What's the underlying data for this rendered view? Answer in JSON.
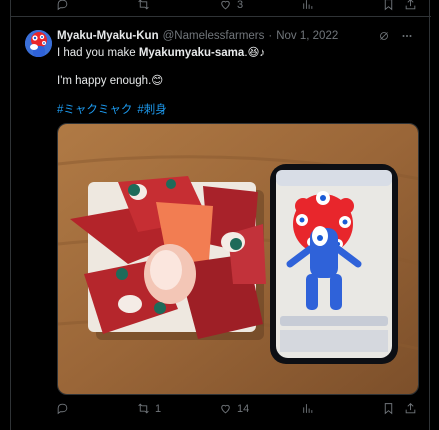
{
  "previous_tweet": {
    "retweets": "",
    "likes": "3",
    "views": ""
  },
  "tweet": {
    "display_name": "Myaku-Myaku-Kun",
    "handle": "@Namelessfarmers",
    "separator": "·",
    "date": "Nov 1, 2022",
    "line1_prefix": "I had you make ",
    "line1_bold": "Myakumyaku-sama",
    "line1_suffix": ".",
    "line1_emoji": "😆♪",
    "line2": "I'm happy enough.",
    "line2_emoji": "😊",
    "hashtags": [
      "#ミャクミャク",
      "#刺身"
    ],
    "stats": {
      "replies": "",
      "retweets": "1",
      "likes": "14",
      "views": ""
    }
  },
  "colors": {
    "background": "#000000",
    "text": "#e7e9ea",
    "muted": "#71767b",
    "link": "#1d9bf0",
    "border": "#2f3336"
  },
  "icons": [
    "reply-icon",
    "retweet-icon",
    "like-icon",
    "views-icon",
    "bookmark-icon",
    "share-icon",
    "grok-icon",
    "more-icon"
  ]
}
